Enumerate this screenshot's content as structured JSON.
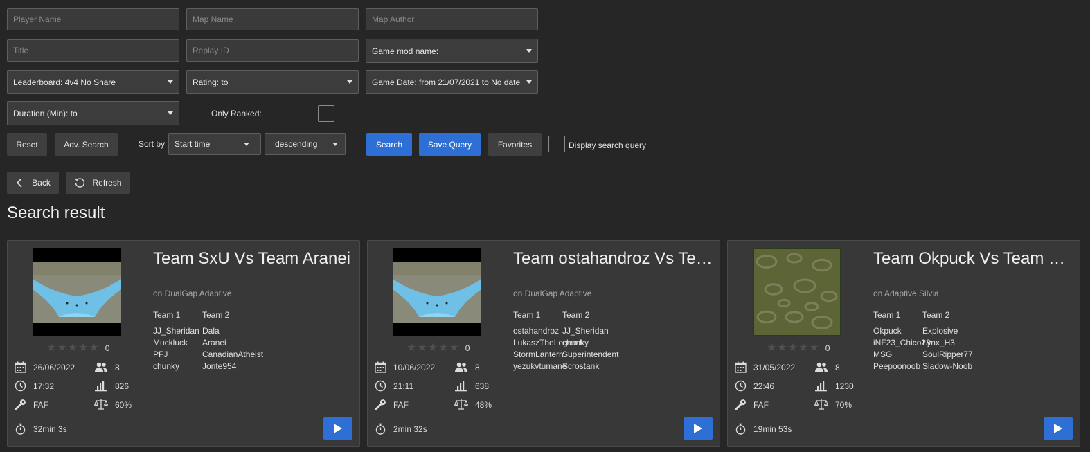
{
  "filters": {
    "player_name_placeholder": "Player Name",
    "map_name_placeholder": "Map Name",
    "map_author_placeholder": "Map Author",
    "title_placeholder": "Title",
    "replay_id_placeholder": "Replay ID",
    "game_mod": "Game mod name:",
    "leaderboard": "Leaderboard: 4v4 No Share",
    "rating": "Rating:  to",
    "game_date": "Game Date: from 21/07/2021 to No date",
    "duration": "Duration (Min):  to",
    "only_ranked_label": "Only Ranked:",
    "only_ranked_checked": false
  },
  "actions": {
    "reset": "Reset",
    "adv_search": "Adv. Search",
    "sort_by_label": "Sort by",
    "sort_field": "Start time",
    "sort_order": "descending",
    "search": "Search",
    "save_query": "Save Query",
    "favorites": "Favorites",
    "display_query_label": "Display search query"
  },
  "nav": {
    "back": "Back",
    "refresh": "Refresh"
  },
  "section_title": "Search result",
  "colors": {
    "accent": "#2d6fd4",
    "background": "#262626",
    "card": "#383838"
  },
  "replays": [
    {
      "title": "Team SxU Vs Team Aranei",
      "map": "on DualGap Adaptive",
      "map_style": "dualgap",
      "rating_stars": 0,
      "rating_value": "0",
      "date": "26/06/2022",
      "players": "8",
      "time": "17:32",
      "avg_rating": "826",
      "mod": "FAF",
      "balance": "60%",
      "duration": "32min 3s",
      "team1_label": "Team 1",
      "team2_label": "Team 2",
      "team1": [
        "JJ_Sheridan",
        "Muckluck",
        "PFJ",
        "chunky"
      ],
      "team2": [
        "Dala",
        "Aranei",
        "CanadianAtheist",
        "Jonte954"
      ]
    },
    {
      "title": "Team ostahandroz Vs Team JJ_Sheridan",
      "map": "on DualGap Adaptive",
      "map_style": "dualgap",
      "rating_stars": 0,
      "rating_value": "0",
      "date": "10/06/2022",
      "players": "8",
      "time": "21:11",
      "avg_rating": "638",
      "mod": "FAF",
      "balance": "48%",
      "duration": "2min 32s",
      "team1_label": "Team 1",
      "team2_label": "Team 2",
      "team1": [
        "ostahandroz",
        "LukaszTheLegend",
        "StormLantern",
        "yezukvtumane"
      ],
      "team2": [
        "JJ_Sheridan",
        "chunky",
        "Superintendent",
        "Scrostank"
      ]
    },
    {
      "title": "Team Okpuck Vs Team Explosive",
      "map": "on Adaptive Silvia",
      "map_style": "silvia",
      "rating_stars": 0,
      "rating_value": "0",
      "date": "31/05/2022",
      "players": "8",
      "time": "22:46",
      "avg_rating": "1230",
      "mod": "FAF",
      "balance": "70%",
      "duration": "19min 53s",
      "team1_label": "Team 1",
      "team2_label": "Team 2",
      "team1": [
        "Okpuck",
        "iNF23_Chico23",
        "MSG",
        "Peepoonoob"
      ],
      "team2": [
        "Explosive",
        "Lynx_H3",
        "SoulRipper77",
        "Sladow-Noob"
      ]
    }
  ]
}
